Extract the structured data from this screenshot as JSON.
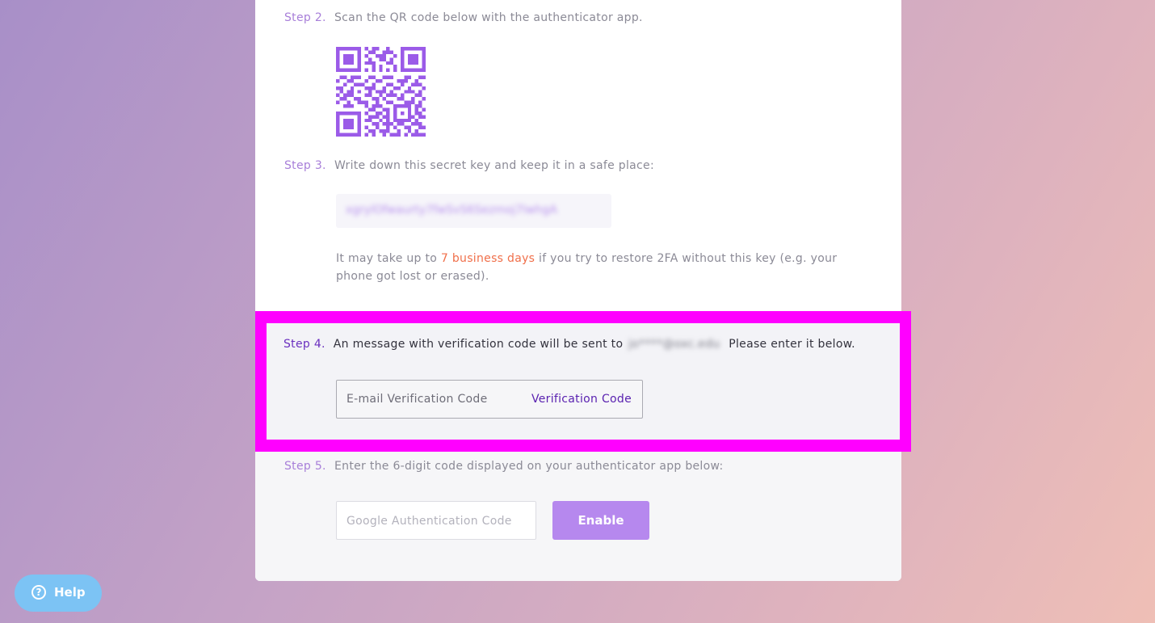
{
  "step2": {
    "num": "Step 2.",
    "text": "Scan the QR code below with the authenticator app."
  },
  "step3": {
    "num": "Step 3.",
    "text": "Write down this secret key and keep it in a safe place:"
  },
  "secret_key": "xgrylOfwaurty7fwSvS6Sezmoj7lwhgA",
  "restore_note": {
    "before": "It may take up to ",
    "accent": "7 business days",
    "after": " if you try to restore 2FA without this key (e.g. your phone got lost or erased)."
  },
  "step4": {
    "num": "Step 4.",
    "text": "An message with verification code will be sent to",
    "email": "jo****@oxc.edu",
    "text2": "Please enter it below."
  },
  "email_code": {
    "placeholder": "E-mail Verification Code",
    "send_label": "Verification Code"
  },
  "step5": {
    "num": "Step 5.",
    "text": "Enter the 6-digit code displayed on your authenticator app below:"
  },
  "ga_code": {
    "placeholder": "Google Authentication Code"
  },
  "enable_label": "Enable",
  "help": {
    "label": "Help",
    "icon": "question-circle-icon"
  },
  "colors": {
    "accent": "#b688ee",
    "highlight": "#ff00ff",
    "warning": "#f06f4a",
    "help": "#7cc3f4"
  }
}
